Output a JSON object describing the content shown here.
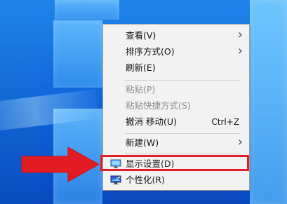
{
  "desktop": {
    "background_colors": {
      "base": "#1a6fd6",
      "pane_light": "#69bfff",
      "pane_dark": "#0a48bf"
    }
  },
  "context_menu": {
    "items": [
      {
        "id": "view",
        "label": "查看(V)",
        "shortcut": "",
        "has_submenu": true,
        "disabled": false,
        "icon": ""
      },
      {
        "id": "sort_by",
        "label": "排序方式(O)",
        "shortcut": "",
        "has_submenu": true,
        "disabled": false,
        "icon": ""
      },
      {
        "id": "refresh",
        "label": "刷新(E)",
        "shortcut": "",
        "has_submenu": false,
        "disabled": false,
        "icon": ""
      },
      {
        "id": "paste",
        "label": "粘贴(P)",
        "shortcut": "",
        "has_submenu": false,
        "disabled": true,
        "icon": ""
      },
      {
        "id": "paste_shortcut",
        "label": "粘贴快捷方式(S)",
        "shortcut": "",
        "has_submenu": false,
        "disabled": true,
        "icon": ""
      },
      {
        "id": "undo_move",
        "label": "撤消 移动(U)",
        "shortcut": "Ctrl+Z",
        "has_submenu": false,
        "disabled": false,
        "icon": ""
      },
      {
        "id": "new",
        "label": "新建(W)",
        "shortcut": "",
        "has_submenu": true,
        "disabled": false,
        "icon": ""
      },
      {
        "id": "display_settings",
        "label": "显示设置(D)",
        "shortcut": "",
        "has_submenu": false,
        "disabled": false,
        "icon": "display-settings-icon"
      },
      {
        "id": "personalize",
        "label": "个性化(R)",
        "shortcut": "",
        "has_submenu": false,
        "disabled": false,
        "icon": "personalize-icon"
      }
    ],
    "accent_colors": {
      "highlight_border": "#df2027",
      "arrow": "#e31b23"
    }
  },
  "annotation": {
    "highlighted_item": "display_settings",
    "pointer_icon": "red-arrow"
  }
}
